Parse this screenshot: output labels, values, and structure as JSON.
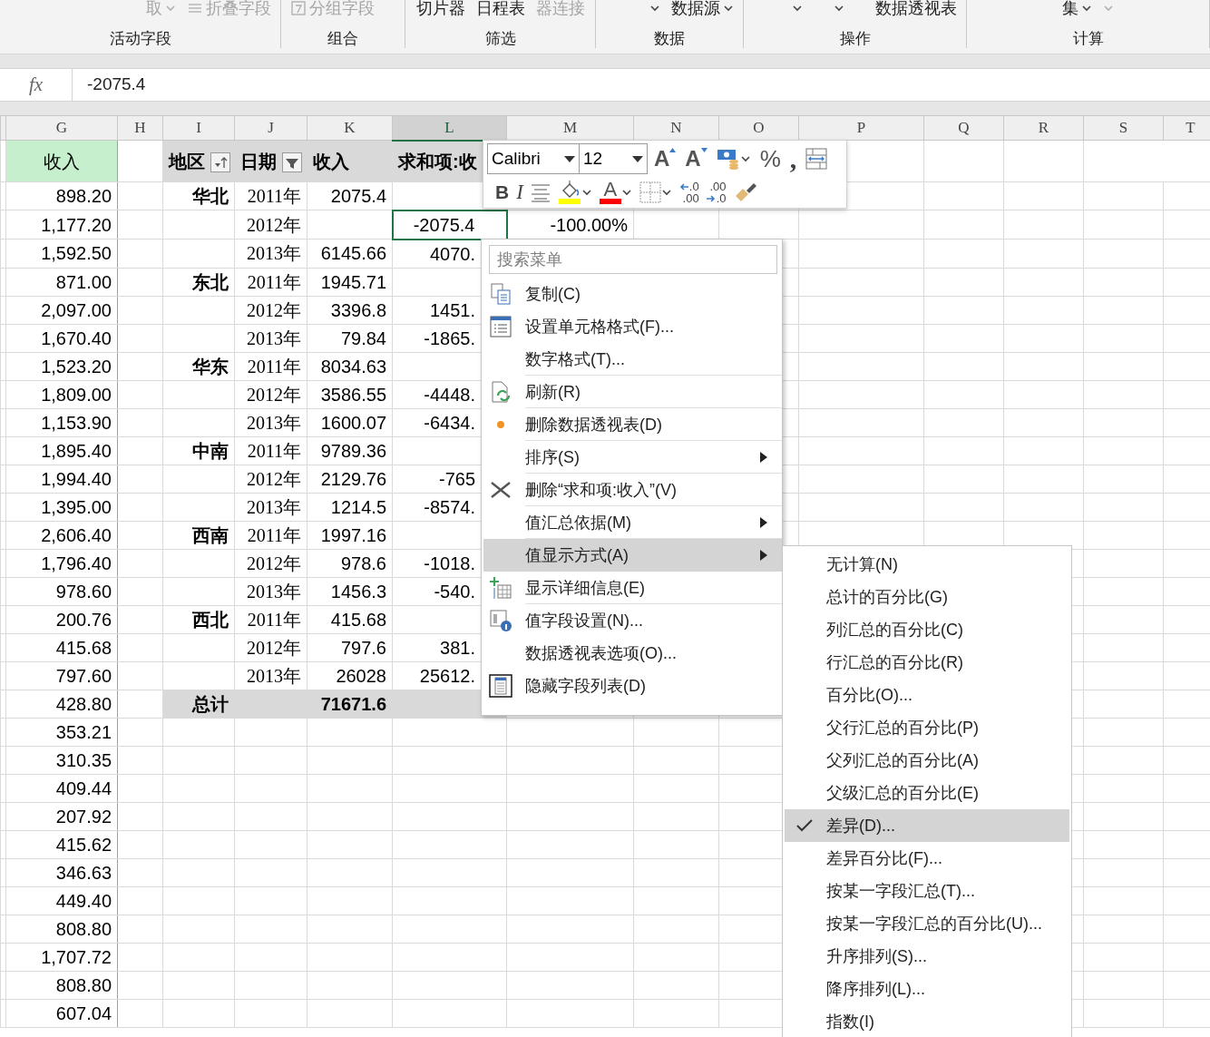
{
  "ribbon": {
    "groups": [
      {
        "label": "活动字段",
        "controls": [
          {
            "kind": "text",
            "text": "取",
            "disabled": true,
            "dropdown": true
          },
          {
            "kind": "icon-text",
            "text": "折叠字段",
            "disabled": true,
            "dropdown": false
          }
        ]
      },
      {
        "label": "组合",
        "controls": [
          {
            "kind": "icon-text",
            "text": "分组字段",
            "disabled": true,
            "dropdown": false
          }
        ]
      },
      {
        "label": "筛选",
        "controls": [
          {
            "kind": "text",
            "text": "切片器",
            "disabled": false,
            "dropdown": false
          },
          {
            "kind": "text",
            "text": "日程表",
            "disabled": false,
            "dropdown": false
          },
          {
            "kind": "text",
            "text": "器连接",
            "disabled": true,
            "dropdown": false
          }
        ]
      },
      {
        "label": "数据",
        "controls": [
          {
            "kind": "caret",
            "disabled": false,
            "dropdown": true
          },
          {
            "kind": "text",
            "text": "数据源",
            "disabled": false,
            "dropdown": true
          }
        ]
      },
      {
        "label": "操作",
        "controls": [
          {
            "kind": "caret",
            "disabled": false,
            "dropdown": true
          },
          {
            "kind": "caret",
            "disabled": false,
            "dropdown": true
          },
          {
            "kind": "text",
            "text": "数据透视表",
            "disabled": false,
            "dropdown": false
          }
        ]
      },
      {
        "label": "计算",
        "controls": [
          {
            "kind": "text",
            "text": "集",
            "disabled": false,
            "dropdown": true
          },
          {
            "kind": "caret",
            "disabled": true,
            "dropdown": true
          }
        ]
      }
    ]
  },
  "formula_bar": {
    "function_label": "fx",
    "value": "-2075.4"
  },
  "columns": [
    {
      "label": "G",
      "selected": false
    },
    {
      "label": "H",
      "selected": false
    },
    {
      "label": "I",
      "selected": false
    },
    {
      "label": "J",
      "selected": false
    },
    {
      "label": "K",
      "selected": false
    },
    {
      "label": "L",
      "selected": true
    },
    {
      "label": "M",
      "selected": false
    },
    {
      "label": "N",
      "selected": false
    },
    {
      "label": "O",
      "selected": false
    },
    {
      "label": "P",
      "selected": false
    },
    {
      "label": "Q",
      "selected": false
    },
    {
      "label": "R",
      "selected": false
    },
    {
      "label": "S",
      "selected": false
    },
    {
      "label": "T",
      "selected": false
    }
  ],
  "income_column": {
    "header": "收入",
    "values": [
      "898.20",
      "1,177.20",
      "1,592.50",
      "871.00",
      "2,097.00",
      "1,670.40",
      "1,523.20",
      "1,809.00",
      "1,153.90",
      "1,895.40",
      "1,994.40",
      "1,395.00",
      "2,606.40",
      "1,796.40",
      "978.60",
      "200.76",
      "415.68",
      "797.60",
      "428.80",
      "353.21",
      "310.35",
      "409.44",
      "207.92",
      "415.62",
      "346.63",
      "449.40",
      "808.80",
      "1,707.72",
      "808.80",
      "607.04"
    ]
  },
  "pivot": {
    "headers": [
      {
        "kind": "sort",
        "text": "地区"
      },
      {
        "kind": "filter",
        "text": "日期"
      },
      {
        "kind": "plain",
        "text": "收入"
      },
      {
        "kind": "plain",
        "text": "求和项:收"
      }
    ],
    "rows": [
      {
        "kind": "data",
        "region": "华北",
        "year": "2011年",
        "income": "2075.4",
        "selected": false
      },
      {
        "kind": "data",
        "year": "2012年",
        "difference": "-2075.4",
        "percent": "-100.00%",
        "selected": true
      },
      {
        "kind": "data",
        "year": "2013年",
        "income": "6145.66",
        "difference": "4070.",
        "selected": false
      },
      {
        "kind": "data",
        "region": "东北",
        "year": "2011年",
        "income": "1945.71",
        "selected": false
      },
      {
        "kind": "data",
        "year": "2012年",
        "income": "3396.8",
        "difference": "1451.",
        "selected": false
      },
      {
        "kind": "data",
        "year": "2013年",
        "income": "79.84",
        "difference": "-1865.",
        "selected": false
      },
      {
        "kind": "data",
        "region": "华东",
        "year": "2011年",
        "income": "8034.63",
        "selected": false
      },
      {
        "kind": "data",
        "year": "2012年",
        "income": "3586.55",
        "difference": "-4448.",
        "selected": false
      },
      {
        "kind": "data",
        "year": "2013年",
        "income": "1600.07",
        "difference": "-6434.",
        "selected": false
      },
      {
        "kind": "data",
        "region": "中南",
        "year": "2011年",
        "income": "9789.36",
        "selected": false
      },
      {
        "kind": "data",
        "year": "2012年",
        "income": "2129.76",
        "difference": "-765",
        "selected": false
      },
      {
        "kind": "data",
        "year": "2013年",
        "income": "1214.5",
        "difference": "-8574.",
        "selected": false
      },
      {
        "kind": "data",
        "region": "西南",
        "year": "2011年",
        "income": "1997.16",
        "selected": false
      },
      {
        "kind": "data",
        "year": "2012年",
        "income": "978.6",
        "difference": "-1018.",
        "selected": false
      },
      {
        "kind": "data",
        "year": "2013年",
        "income": "1456.3",
        "difference": "-540.",
        "selected": false
      },
      {
        "kind": "data",
        "region": "西北",
        "year": "2011年",
        "income": "415.68",
        "selected": false
      },
      {
        "kind": "data",
        "year": "2012年",
        "income": "797.6",
        "difference": "381.",
        "selected": false
      },
      {
        "kind": "data",
        "year": "2013年",
        "income": "26028",
        "difference": "25612.",
        "selected": false
      },
      {
        "kind": "total",
        "region": "总计",
        "income": "71671.6",
        "selected": false
      }
    ]
  },
  "mini_toolbar": {
    "font": "Calibri",
    "size": "12",
    "row_1": [
      {
        "kind": "grow-font",
        "text": "A",
        "dropdown": false
      },
      {
        "kind": "shrink-font",
        "text": "A",
        "dropdown": false
      },
      {
        "kind": "accounting",
        "dropdown": true
      },
      {
        "kind": "percent",
        "text": "%",
        "dropdown": false
      },
      {
        "kind": "comma",
        "text": ",",
        "dropdown": false
      },
      {
        "kind": "wrap",
        "dropdown": false
      }
    ],
    "row_2": [
      {
        "kind": "bold",
        "text": "B",
        "dropdown": false
      },
      {
        "kind": "italic",
        "text": "I",
        "dropdown": false
      },
      {
        "kind": "center",
        "dropdown": false
      },
      {
        "kind": "fill",
        "color": "#ffff00",
        "dropdown": true
      },
      {
        "kind": "font-color",
        "text": "A",
        "color": "#ff0000",
        "dropdown": true
      },
      {
        "kind": "borders",
        "dropdown": true
      },
      {
        "kind": "increase-decimal",
        "lines": [
          ".0",
          ".00"
        ],
        "dropdown": false
      },
      {
        "kind": "decrease-decimal",
        "lines": [
          ".00",
          ".0"
        ],
        "dropdown": false
      },
      {
        "kind": "painter",
        "dropdown": false
      }
    ]
  },
  "context_menu": {
    "search": {
      "placeholder": "搜索菜单"
    },
    "items": [
      {
        "kind": "copy",
        "label": "复制(C)",
        "submenu": false,
        "selected": false,
        "separator": false
      },
      {
        "kind": "format",
        "label": "设置单元格格式(F)...",
        "submenu": false,
        "selected": false,
        "separator": false
      },
      {
        "kind": "plain",
        "label": "数字格式(T)...",
        "submenu": false,
        "selected": false,
        "separator": true
      },
      {
        "kind": "refresh",
        "label": "刷新(R)",
        "submenu": false,
        "selected": false,
        "separator": true
      },
      {
        "kind": "dot",
        "label": "删除数据透视表(D)",
        "submenu": false,
        "selected": false,
        "separator": true
      },
      {
        "kind": "plain",
        "label": "排序(S)",
        "submenu": true,
        "selected": false,
        "separator": true
      },
      {
        "kind": "cross",
        "label": "删除“求和项:收入”(V)",
        "submenu": false,
        "selected": false,
        "separator": true
      },
      {
        "kind": "plain",
        "label": "值汇总依据(M)",
        "submenu": true,
        "selected": false,
        "separator": true
      },
      {
        "kind": "plain",
        "label": "值显示方式(A)",
        "submenu": true,
        "selected": true,
        "separator": false
      },
      {
        "kind": "details",
        "label": "显示详细信息(E)",
        "submenu": false,
        "selected": false,
        "separator": true
      },
      {
        "kind": "field-settings",
        "label": "值字段设置(N)...",
        "submenu": false,
        "selected": false,
        "separator": false
      },
      {
        "kind": "plain",
        "label": "数据透视表选项(O)...",
        "submenu": false,
        "selected": false,
        "separator": false
      },
      {
        "kind": "field-list",
        "label": "隐藏字段列表(D)",
        "submenu": false,
        "selected": false,
        "separator": false
      }
    ]
  },
  "submenu": {
    "items": [
      {
        "label": "无计算(N)",
        "checked": false,
        "selected": false
      },
      {
        "label": "总计的百分比(G)",
        "checked": false,
        "selected": false
      },
      {
        "label": "列汇总的百分比(C)",
        "checked": false,
        "selected": false
      },
      {
        "label": "行汇总的百分比(R)",
        "checked": false,
        "selected": false
      },
      {
        "label": "百分比(O)...",
        "checked": false,
        "selected": false
      },
      {
        "label": "父行汇总的百分比(P)",
        "checked": false,
        "selected": false
      },
      {
        "label": "父列汇总的百分比(A)",
        "checked": false,
        "selected": false
      },
      {
        "label": "父级汇总的百分比(E)",
        "checked": false,
        "selected": false
      },
      {
        "label": "差异(D)...",
        "checked": true,
        "selected": true
      },
      {
        "label": "差异百分比(F)...",
        "checked": false,
        "selected": false
      },
      {
        "label": "按某一字段汇总(T)...",
        "checked": false,
        "selected": false
      },
      {
        "label": "按某一字段汇总的百分比(U)...",
        "checked": false,
        "selected": false
      },
      {
        "label": "升序排列(S)...",
        "checked": false,
        "selected": false
      },
      {
        "label": "降序排列(L)...",
        "checked": false,
        "selected": false
      },
      {
        "label": "指数(I)",
        "checked": false,
        "selected": false
      }
    ]
  }
}
